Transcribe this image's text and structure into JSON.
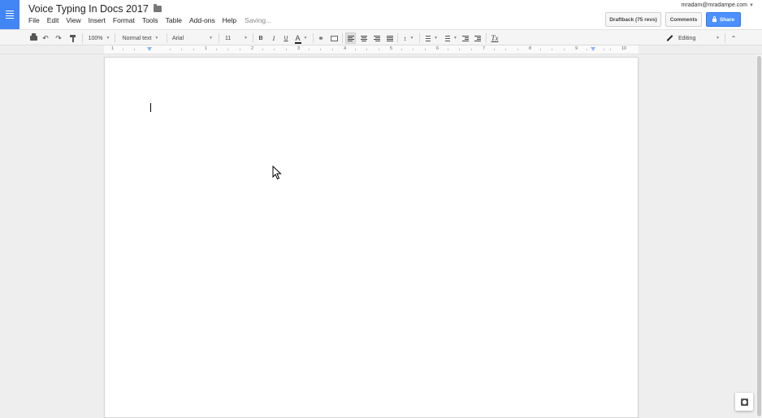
{
  "header": {
    "title": "Voice Typing In Docs 2017",
    "menu": [
      "File",
      "Edit",
      "View",
      "Insert",
      "Format",
      "Tools",
      "Table",
      "Add-ons",
      "Help"
    ],
    "status": "Saving...",
    "account": "mradam@mradampe.com",
    "draftback_label": "Draftback (75 revs)",
    "comments_label": "Comments",
    "share_label": "Share"
  },
  "toolbar": {
    "zoom": "100%",
    "style": "Normal text",
    "font": "Arial",
    "size": "11",
    "bold": "B",
    "italic": "I",
    "underline": "U",
    "text_color": "A",
    "clear_format": "Tx",
    "mode": "Editing"
  },
  "ruler": {
    "numbers": [
      "1",
      "1",
      "2",
      "3",
      "4",
      "5",
      "6",
      "7",
      "8",
      "9",
      "10"
    ]
  },
  "colors": {
    "accent": "#4285f4",
    "share": "#4d90fe",
    "canvas": "#eeeeee"
  },
  "icons": [
    "docs-logo",
    "star-icon",
    "folder-icon",
    "print-icon",
    "undo-icon",
    "redo-icon",
    "paint-format-icon",
    "link-icon",
    "comment-icon",
    "align-left-icon",
    "align-center-icon",
    "align-right-icon",
    "justify-icon",
    "line-spacing-icon",
    "numbered-list-icon",
    "bulleted-list-icon",
    "decrease-indent-icon",
    "increase-indent-icon",
    "clear-formatting-icon",
    "pencil-icon",
    "collapse-icon",
    "explore-icon"
  ]
}
